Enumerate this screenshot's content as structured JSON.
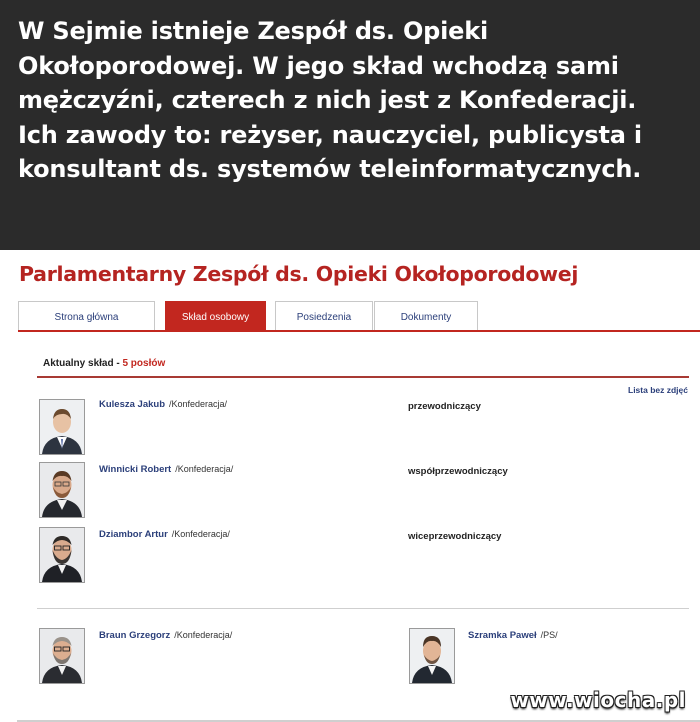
{
  "caption": {
    "text": "W Sejmie istnieje Zespół ds. Opieki Okołoporodowej. W jego skład wchodzą sami mężczyźni, czterech z nich jest z Konfederacji. Ich zawody to: reżyser, nauczyciel, publicysta i konsultant ds. systemów teleinformatycznych."
  },
  "page": {
    "title": "Parlamentarny Zespół ds. Opieki Okołoporodowej",
    "tabs": [
      {
        "label": "Strona główna",
        "active": false
      },
      {
        "label": "Skład osobowy",
        "active": true
      },
      {
        "label": "Posiedzenia",
        "active": false
      },
      {
        "label": "Dokumenty",
        "active": false
      }
    ],
    "section": {
      "label": "Aktualny skład - ",
      "count": "5 posłów"
    },
    "no_photo_link": "Lista bez zdjęć",
    "members": [
      {
        "name": "Kulesza Jakub",
        "club": "/Konfederacja/",
        "role": "przewodniczący"
      },
      {
        "name": "Winnicki Robert",
        "club": "/Konfederacja/",
        "role": "współprzewodniczący"
      },
      {
        "name": "Dziambor Artur",
        "club": "/Konfederacja/",
        "role": "wiceprzewodniczący"
      },
      {
        "name": "Braun Grzegorz",
        "club": "/Konfederacja/",
        "role": ""
      },
      {
        "name": "Szramka Paweł",
        "club": "/PS/",
        "role": ""
      }
    ]
  },
  "watermark": "www.wiocha.pl",
  "colors": {
    "caption_bg": "#2b2b2b",
    "accent_red": "#c2271f",
    "link_blue": "#2b3f7a"
  }
}
